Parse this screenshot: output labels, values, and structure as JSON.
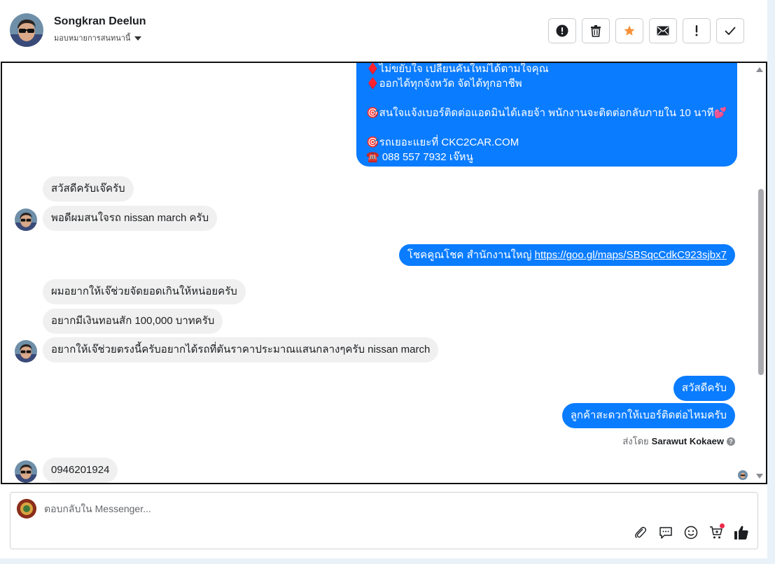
{
  "header": {
    "contact_name": "Songkran Deelun",
    "assign_label": "มอบหมายการสนทนานี้",
    "actions": [
      {
        "name": "report-spam",
        "icon": "alert-circle-icon"
      },
      {
        "name": "delete",
        "icon": "trash-icon"
      },
      {
        "name": "star",
        "icon": "star-icon"
      },
      {
        "name": "mark-unread",
        "icon": "envelope-icon"
      },
      {
        "name": "follow-up",
        "icon": "exclamation-icon"
      },
      {
        "name": "mark-done",
        "icon": "check-icon"
      }
    ],
    "star_color": "#f7923a"
  },
  "conversation": {
    "big_message_lines": [
      "♦️ไม่ขยับใจ เปลี่ยนคันใหม่ได้ตามใจคุณ",
      "♦️ออกได้ทุกจังหวัด จัดได้ทุกอาชีพ",
      "",
      "🎯สนใจแจ้งเบอร์ติดต่อแอดมินได้เลยจ้า พนักงานจะติดต่อกลับภายใน 10 นาที💕",
      "",
      "🎯รถเยอะแยะที่ CKC2CAR.COM",
      "☎️ 088 557 7932 เจ๊หนู"
    ],
    "incoming_1": "สวัสดีครับเจ๊ครับ",
    "incoming_2": "พอดีผมสนใจรถ nissan march ครับ",
    "outgoing_link_prefix": "โชคคูณโชค สำนักงานใหญ่ ",
    "outgoing_link_url": "https://goo.gl/maps/SBSqcCdkC923sjbx7",
    "incoming_3": "ผมอยากให้เจ๊ช่วยจัดยอดเกินให้หน่อยครับ",
    "incoming_4": "อยากมีเงินทอนสัก 100,000 บาทครับ",
    "incoming_5": "อยากให้เจ๊ช่วยตรงนี้ครับอยากได้รถที่ตันราคาประมาณแสนกลางๆครับ nissan march",
    "outgoing_2": "สวัสดีครับ",
    "outgoing_3": "ลูกค้าสะดวกให้เบอร์ติดต่อไหมครับ",
    "sent_by_label": "ส่งโดย",
    "sent_by_name": "Sarawut Kokaew",
    "incoming_6": "0946201924",
    "outgoing_bubble_color": "#0a7cff",
    "incoming_bubble_color": "#f0f0f0"
  },
  "composer": {
    "placeholder": "ตอบกลับใน Messenger...",
    "tools": [
      "paperclip-icon",
      "speech-bubble-icon",
      "smiley-icon",
      "cart-icon",
      "thumbs-up-icon"
    ]
  }
}
